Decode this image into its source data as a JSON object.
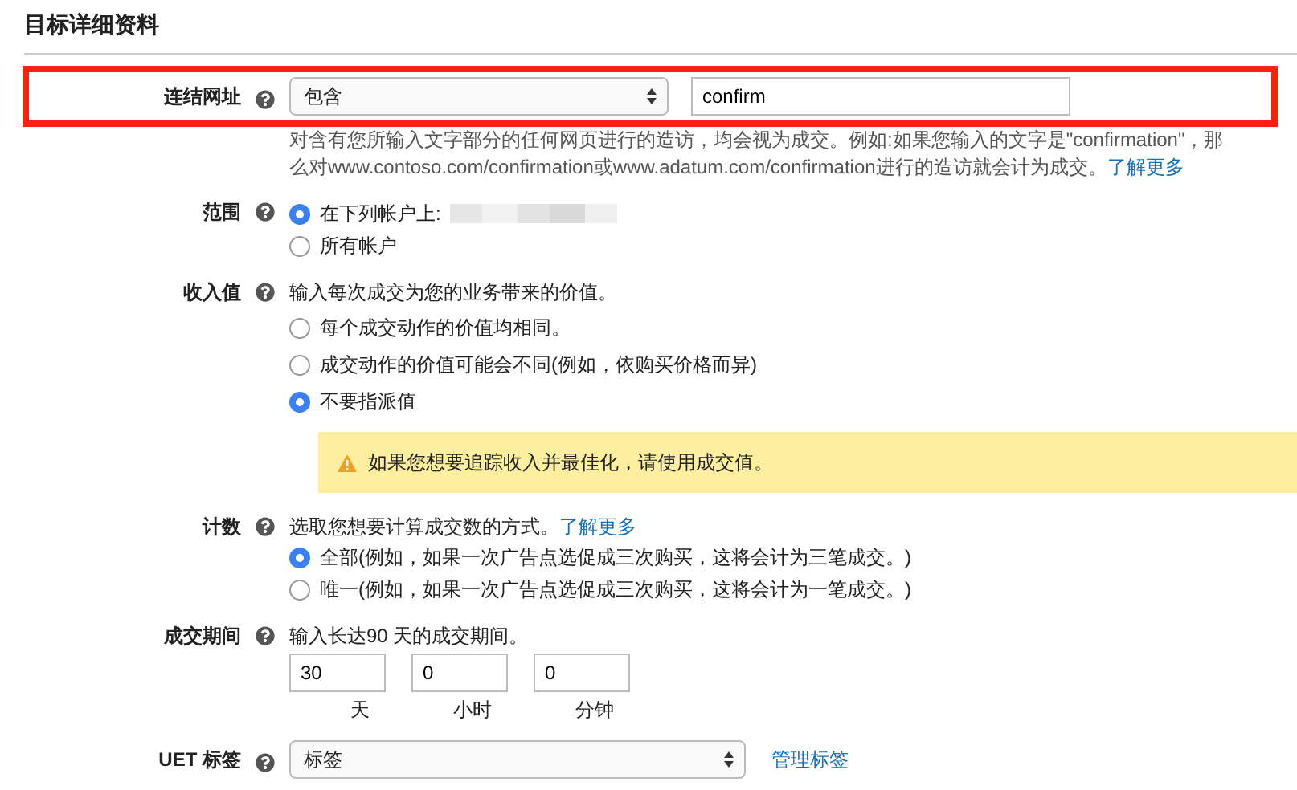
{
  "section_title": "目标详细资料",
  "url": {
    "label": "连结网址",
    "highlighted": true,
    "operator": "包含",
    "value": "confirm",
    "help_text": "对含有您所输入文字部分的任何网页进行的造访，均会视为成交。例如:如果您输入的文字是\"confirmation\"，那么对www.contoso.com/confirmation或www.adatum.com/confirmation进行的造访就会计为成交。",
    "help_link": "了解更多"
  },
  "scope": {
    "label": "范围",
    "options": [
      {
        "label": "在下列帐户上:",
        "selected": true,
        "redacted": true
      },
      {
        "label": "所有帐户",
        "selected": false,
        "redacted": false
      }
    ]
  },
  "revenue": {
    "label": "收入值",
    "intro": "输入每次成交为您的业务带来的价值。",
    "options": [
      {
        "label": "每个成交动作的价值均相同。",
        "selected": false
      },
      {
        "label": "成交动作的价值可能会不同(例如，依购买价格而异)",
        "selected": false
      },
      {
        "label": "不要指派值",
        "selected": true
      }
    ],
    "warning": "如果您想要追踪收入并最佳化，请使用成交值。"
  },
  "count": {
    "label": "计数",
    "intro": "选取您想要计算成交数的方式。",
    "link": "了解更多",
    "options": [
      {
        "label": "全部(例如，如果一次广告点选促成三次购买，这将会计为三笔成交。)",
        "selected": true
      },
      {
        "label": "唯一(例如，如果一次广告点选促成三次购买，这将会计为一笔成交。)",
        "selected": false
      }
    ]
  },
  "period": {
    "label": "成交期间",
    "intro": "输入长达90 天的成交期间。",
    "inputs": [
      {
        "value": "30",
        "unit": "天"
      },
      {
        "value": "0",
        "unit": "小时"
      },
      {
        "value": "0",
        "unit": "分钟"
      }
    ]
  },
  "uet": {
    "label": "UET 标签",
    "select": "标签",
    "link": "管理标签"
  }
}
